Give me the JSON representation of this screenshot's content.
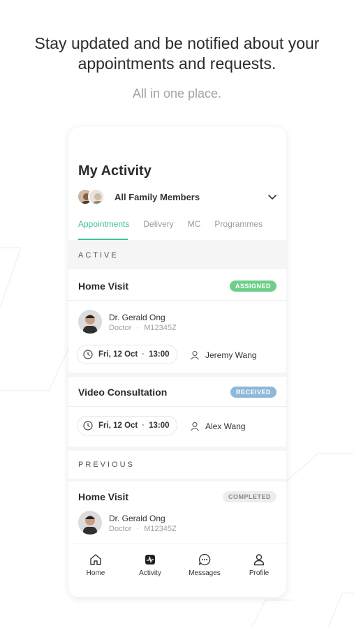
{
  "hero": {
    "title": "Stay updated and be notified about your appointments and requests.",
    "subtitle": "All in one place."
  },
  "screen": {
    "title": "My Activity",
    "family_selector": {
      "label": "All Family Members",
      "icon": "chevron-down-icon"
    },
    "tabs": [
      {
        "label": "Appointments",
        "active": true
      },
      {
        "label": "Delivery",
        "active": false
      },
      {
        "label": "MC",
        "active": false
      },
      {
        "label": "Programmes",
        "active": false
      }
    ],
    "sections": {
      "active_label": "ACTIVE",
      "previous_label": "PREVIOUS"
    },
    "cards": [
      {
        "title": "Home Visit",
        "status": "ASSIGNED",
        "doctor": {
          "name": "Dr. Gerald Ong",
          "role": "Doctor",
          "id": "M12345Z"
        },
        "date": "Fri, 12 Oct",
        "time": "13:00",
        "patient": "Jeremy Wang"
      },
      {
        "title": "Video Consultation",
        "status": "RECEIVED",
        "date": "Fri, 12 Oct",
        "time": "13:00",
        "patient": "Alex Wang"
      },
      {
        "title": "Home Visit",
        "status": "COMPLETED",
        "doctor": {
          "name": "Dr. Gerald Ong",
          "role": "Doctor",
          "id": "M12345Z"
        }
      }
    ],
    "separator": "·",
    "bottom_nav": [
      {
        "label": "Home",
        "icon": "home-icon"
      },
      {
        "label": "Activity",
        "icon": "activity-icon"
      },
      {
        "label": "Messages",
        "icon": "messages-icon"
      },
      {
        "label": "Profile",
        "icon": "profile-icon"
      }
    ]
  },
  "colors": {
    "accent": "#3fbf9c",
    "assigned": "#6fcf8a",
    "received": "#8eb7d8",
    "completed": "#ededed"
  }
}
